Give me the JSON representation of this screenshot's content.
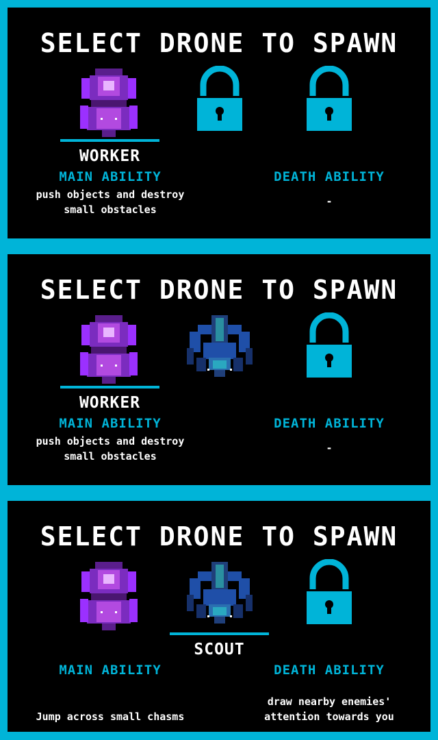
{
  "colors": {
    "accent": "#00b4d8",
    "background": "#000000",
    "worker": "#9b30ff",
    "scout": "#1f4fa8"
  },
  "panels": [
    {
      "title": "SELECT DRONE TO SPAWN",
      "slots": [
        "worker-drone",
        "locked",
        "locked"
      ],
      "selected_slot": 1,
      "drone_name": "WORKER",
      "main_ability_label": "MAIN ABILITY",
      "main_ability_text": "push objects and destroy small obstacles",
      "death_ability_label": "DEATH ABILITY",
      "death_ability_text": "-"
    },
    {
      "title": "SELECT DRONE TO SPAWN",
      "slots": [
        "worker-drone",
        "scout-drone",
        "locked"
      ],
      "selected_slot": 1,
      "drone_name": "WORKER",
      "main_ability_label": "MAIN ABILITY",
      "main_ability_text": "push objects and destroy small obstacles",
      "death_ability_label": "DEATH ABILITY",
      "death_ability_text": "-"
    },
    {
      "title": "SELECT DRONE TO SPAWN",
      "slots": [
        "worker-drone",
        "scout-drone",
        "locked"
      ],
      "selected_slot": 2,
      "drone_name": "SCOUT",
      "main_ability_label": "MAIN ABILITY",
      "main_ability_text": "Jump across small chasms",
      "death_ability_label": "DEATH ABILITY",
      "death_ability_text": "draw nearby enemies' attention towards you"
    }
  ]
}
